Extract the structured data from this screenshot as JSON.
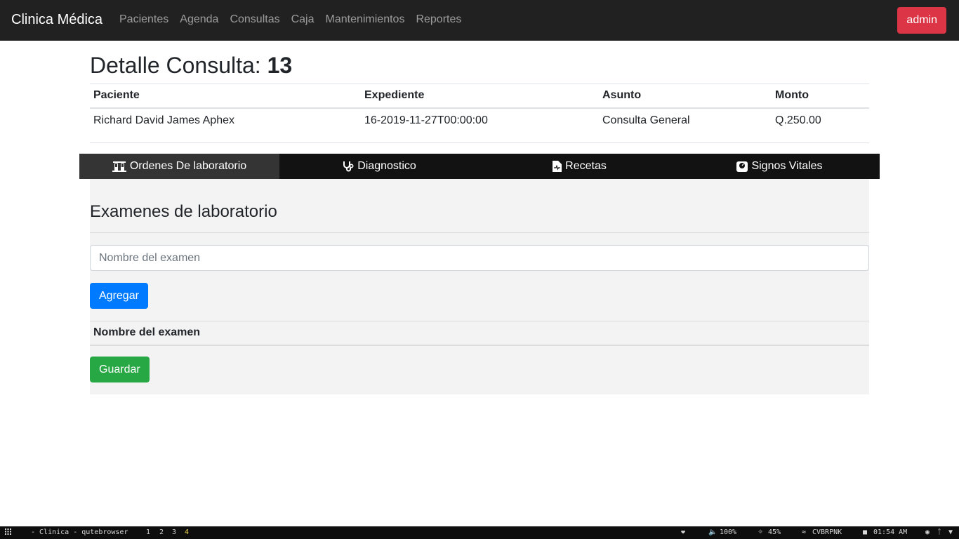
{
  "navbar": {
    "brand": "Clinica Médica",
    "links": [
      "Pacientes",
      "Agenda",
      "Consultas",
      "Caja",
      "Mantenimientos",
      "Reportes"
    ],
    "user_button": "admin"
  },
  "page": {
    "title_prefix": "Detalle Consulta:",
    "title_number": "13"
  },
  "summary_table": {
    "headers": [
      "Paciente",
      "Expediente",
      "Asunto",
      "Monto"
    ],
    "row": [
      "Richard David James Aphex",
      "16-2019-11-27T00:00:00",
      "Consulta General",
      "Q.250.00"
    ]
  },
  "tabs": [
    {
      "label": "Ordenes De laboratorio",
      "icon": "vials-icon",
      "active": true
    },
    {
      "label": "Diagnostico",
      "icon": "stethoscope-icon",
      "active": false
    },
    {
      "label": "Recetas",
      "icon": "file-medical-icon",
      "active": false
    },
    {
      "label": "Signos Vitales",
      "icon": "weight-icon",
      "active": false
    }
  ],
  "lab_panel": {
    "title": "Examenes de laboratorio",
    "input_placeholder": "Nombre del examen",
    "add_button": "Agregar",
    "table_header": "Nombre del examen",
    "save_button": "Guardar"
  },
  "taskbar": {
    "window_title": "- Clinica - qutebrowser",
    "workspaces": [
      "1",
      "2",
      "3",
      "4"
    ],
    "active_workspace": "4",
    "volume": "100%",
    "brightness": "45%",
    "wifi": "CVBRPNK",
    "time": "01:54 AM"
  },
  "colors": {
    "navbar_bg": "#212121",
    "admin_button": "#dc3545",
    "add_button": "#007bff",
    "save_button": "#28a745",
    "tabs_bg": "#121212",
    "active_tab_bg": "#343434",
    "panel_bg": "#f3f3f3"
  }
}
